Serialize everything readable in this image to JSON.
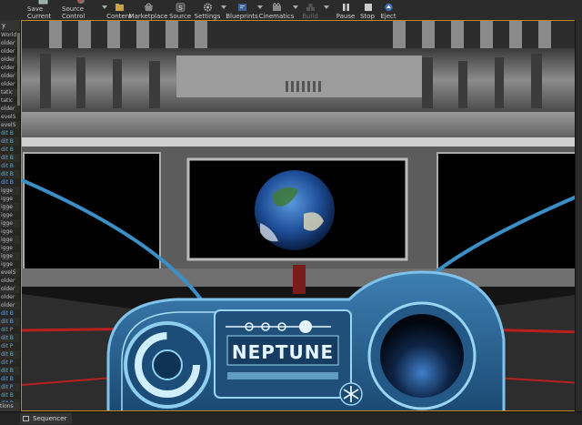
{
  "toolbar": {
    "buttons": [
      {
        "label": "Save Current",
        "icon": "save-icon"
      },
      {
        "label": "Source Control",
        "icon": "source-control-icon"
      },
      {
        "label": "Content",
        "icon": "content-icon"
      },
      {
        "label": "Marketplace",
        "icon": "marketplace-icon"
      },
      {
        "label": "Source",
        "icon": "source-icon"
      },
      {
        "label": "Settings",
        "icon": "gear-icon"
      },
      {
        "label": "Blueprints",
        "icon": "blueprints-icon"
      },
      {
        "label": "Cinematics",
        "icon": "cinematics-icon"
      },
      {
        "label": "Build",
        "icon": "build-icon",
        "disabled": true
      },
      {
        "label": "Pause",
        "icon": "pause-icon"
      },
      {
        "label": "Stop",
        "icon": "stop-icon"
      },
      {
        "label": "Eject",
        "icon": "eject-icon"
      }
    ]
  },
  "outliner": {
    "header": "y",
    "rows": [
      "World",
      "older",
      "older",
      "older",
      "older",
      "older",
      "older",
      "tatic",
      "tatic",
      "older",
      "evelS",
      "evelS",
      "dit B",
      "dit B",
      "dit B",
      "dit B",
      "dit B",
      "dit B",
      "dit B",
      "igge",
      "igge",
      "igge",
      "igge",
      "igge",
      "igge",
      "igge",
      "igge",
      "igge",
      "igge",
      "evelS",
      "older",
      "older",
      "older",
      "older",
      "dit B",
      "dit B",
      "dit P",
      "dit B",
      "dit P",
      "dit B",
      "dit P",
      "dit B",
      "dit B",
      "dit P",
      "dit B",
      "dit B",
      "dit B",
      "dit B"
    ],
    "footer": "tions"
  },
  "viewport": {
    "hud_title": "NEPTUNE"
  },
  "bottombar": {
    "sequencer_tab": "Sequencer"
  },
  "colors": {
    "accent": "#c28a22",
    "hud_blue": "#3b8fc7",
    "hud_light": "#7fc3ea",
    "outliner_link": "#5aa8ff"
  }
}
